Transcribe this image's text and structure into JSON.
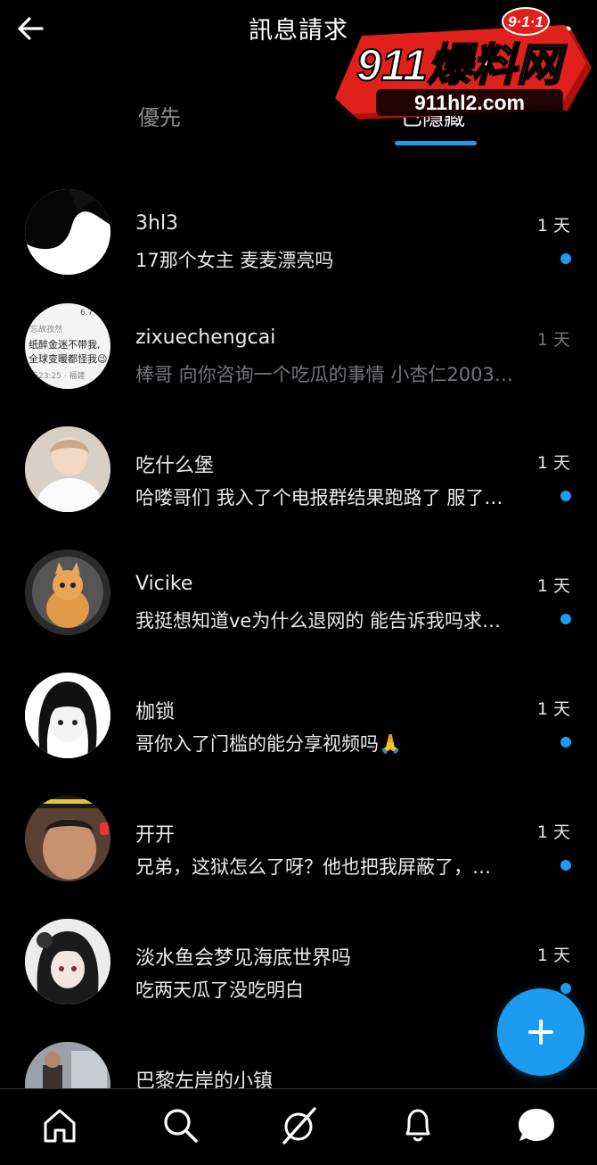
{
  "header": {
    "title": "訊息請求",
    "back_icon": "arrow-left-icon",
    "more_icon": "more-icon"
  },
  "tabs": [
    {
      "label": "優先",
      "active": false
    },
    {
      "label": "已隱藏",
      "active": true
    }
  ],
  "watermark": {
    "badge": "9·1·1",
    "brand": "911爆料网",
    "url": "911hl2.com"
  },
  "messages": [
    {
      "user": "3hl3",
      "time": "1 天",
      "text": "17那个女主 麦麦漂亮吗",
      "unread": true
    },
    {
      "user": "zixuechengcai",
      "time": "1 天",
      "text": "棒哥 向你咨询一个吃瓜的事情 小杏仁2003…",
      "unread": false
    },
    {
      "user": "吃什么堡",
      "time": "1 天",
      "text": "哈喽哥们 我入了个电报群结果跑路了 服了…",
      "unread": true
    },
    {
      "user": "Vicike",
      "time": "1 天",
      "text": "我挺想知道ve为什么退网的 能告诉我吗求…",
      "unread": true
    },
    {
      "user": "枷锁",
      "time": "1 天",
      "text": "哥你入了门槛的能分享视频吗🙏",
      "unread": true
    },
    {
      "user": "开开",
      "time": "1 天",
      "text": "兄弟，这狱怎么了呀？他也把我屏蔽了，…",
      "unread": true
    },
    {
      "user": "淡水鱼会梦见海底世界吗",
      "time": "1 天",
      "text": "吃两天瓜了没吃明白",
      "unread": true
    },
    {
      "user": "巴黎左岸的小镇",
      "time": "",
      "text": "",
      "unread": false
    }
  ],
  "avatar2_text": [
    "6.7",
    "忘故孜然",
    "纸醉金迷不带我,",
    "全球变暖都怪我😉",
    "天23:25 · 福建"
  ],
  "fab": {
    "icon": "plus-icon"
  },
  "nav": [
    {
      "icon": "home-icon"
    },
    {
      "icon": "search-icon"
    },
    {
      "icon": "grok-icon"
    },
    {
      "icon": "bell-icon"
    },
    {
      "icon": "messages-icon"
    }
  ],
  "colors": {
    "accent": "#1d9bf0",
    "background": "#000000",
    "muted": "#71767b",
    "watermark_red": "#e0201b"
  }
}
